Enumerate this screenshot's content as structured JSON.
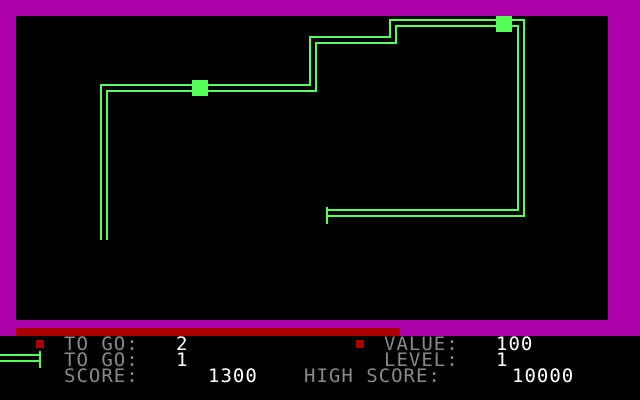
{
  "colors": {
    "frame": "#AA00AA",
    "background": "#000000",
    "track": "#55FF55",
    "timer_bar": "#AA0000",
    "marker": "#AA0000",
    "label_text": "#8A8A8A",
    "value_text": "#FFFFFF"
  },
  "hud": {
    "row1": {
      "to_go_label": "TO GO:",
      "to_go_value": "2",
      "value_label": "VALUE:",
      "value_value": "100"
    },
    "row2": {
      "to_go_label": "TO GO:",
      "to_go_value": "1",
      "level_label": "LEVEL:",
      "level_value": "1"
    },
    "row3": {
      "score_label": "SCORE:",
      "score_value": "1300",
      "high_score_label": "HIGH SCORE:",
      "high_score_value": "10000"
    }
  },
  "icons": {
    "lives": "pipe-life-icon",
    "row_marker": "square-marker-icon",
    "pickup": "green-square-pickup-icon",
    "track_end": "track-head-icon"
  }
}
